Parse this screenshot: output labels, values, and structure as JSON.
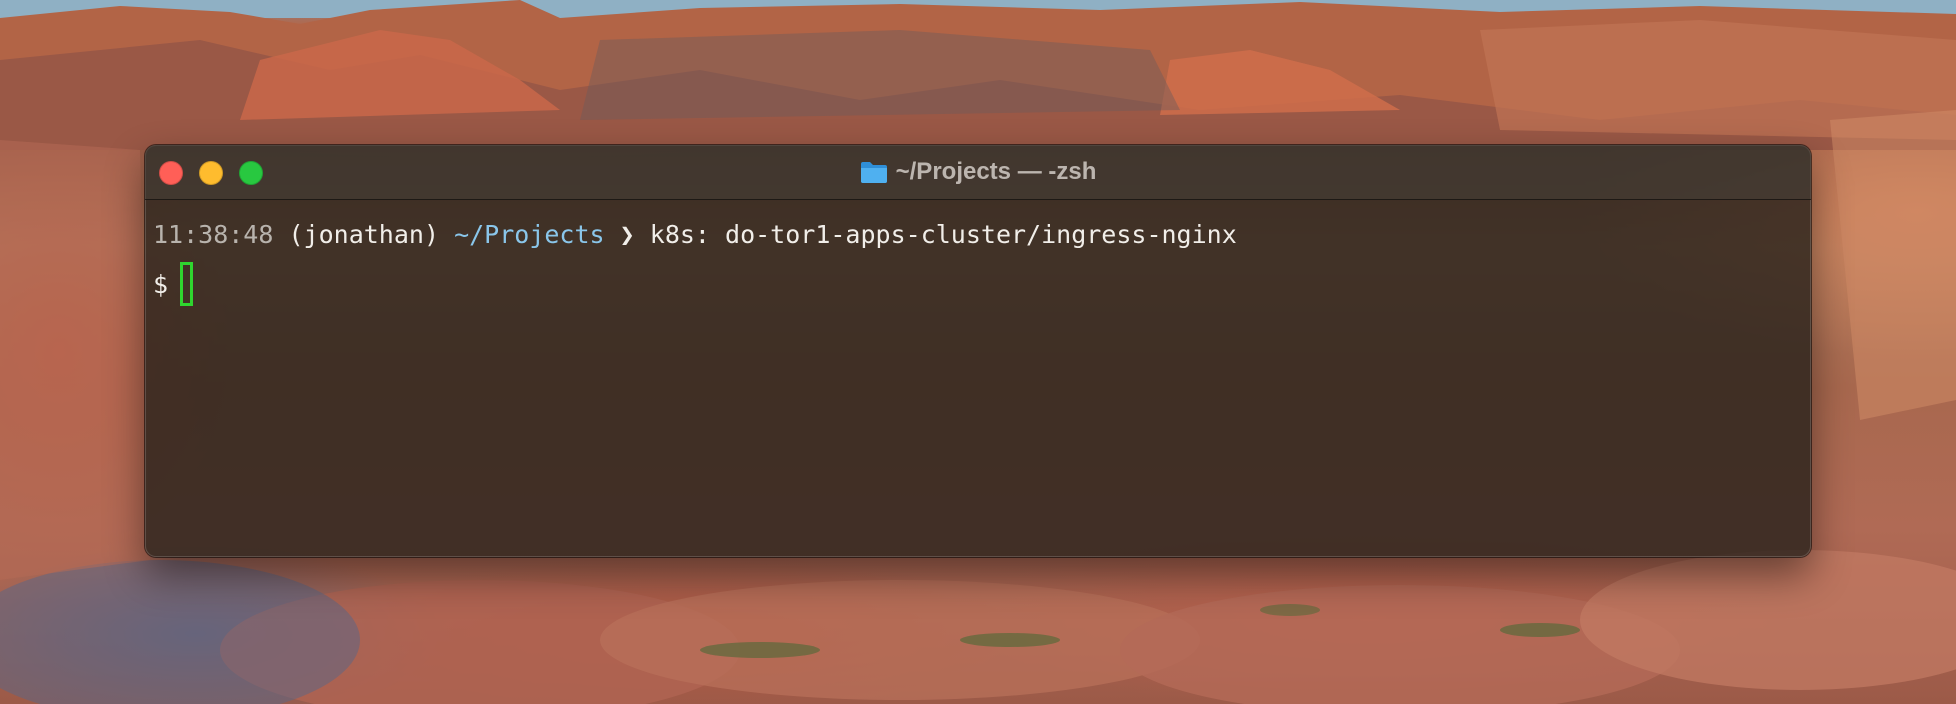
{
  "window": {
    "title": "~/Projects — -zsh",
    "folder_icon": "folder-icon",
    "controls": {
      "close_color": "#ff5f57",
      "minimize_color": "#febc2e",
      "zoom_color": "#28c840"
    }
  },
  "terminal": {
    "status_line": {
      "time": "11:38:48",
      "user": "(jonathan)",
      "cwd": "~/Projects",
      "separator": "❯",
      "context": "k8s: do-tor1-apps-cluster/ingress-nginx"
    },
    "prompt": {
      "symbol": "$",
      "input": ""
    },
    "colors": {
      "cwd": "#8ac6ea",
      "cursor": "#2fd52f"
    }
  }
}
